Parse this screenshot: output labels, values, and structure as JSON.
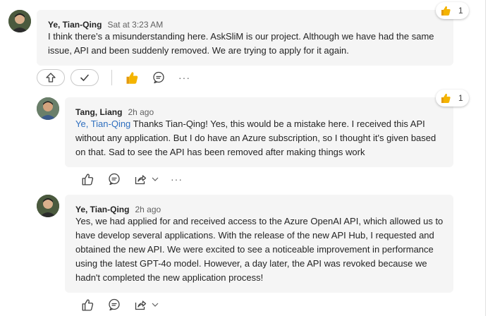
{
  "messages": [
    {
      "author": "Ye, Tian-Qing",
      "time": "Sat at 3:23 AM",
      "body": "I think there’s a misunderstanding here. AskSliM is our project. Although we have had the same issue, API and been suddenly removed. We are trying to apply for it again.",
      "reaction": {
        "icon": "thumbs-up-emoji",
        "count": "1"
      }
    },
    {
      "author": "Tang, Liang",
      "time": "2h ago",
      "mention": "Ye, Tian-Qing",
      "body": " Thanks Tian-Qing! Yes, this would be a mistake here. I received this API without any application. But I do have an Azure subscription, so I thought it's given based on that. Sad to see the API has been removed after making things work",
      "reaction": {
        "icon": "thumbs-up-emoji",
        "count": "1"
      }
    },
    {
      "author": "Ye, Tian-Qing",
      "time": "2h ago",
      "body": "Yes, we had applied for and received access to the Azure OpenAI API, which allowed us to have develop several applications. With the release of the new API Hub, I requested and obtained the new API. We were excited to see a noticeable improvement in performance using the latest GPT-4o model. However, a day later, the API was revoked because we hadn't completed the new application process!"
    }
  ],
  "actions": {
    "more": "···"
  },
  "colors": {
    "bubble": "#f5f5f5",
    "mention": "#2f6fbf",
    "like": "#f4b400"
  }
}
